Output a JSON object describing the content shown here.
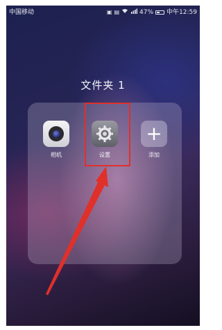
{
  "status_bar": {
    "carrier": "中国移动",
    "battery_percent": "47%",
    "battery_level": 0.47,
    "time": "中午12:59",
    "icons": [
      "nfc-icon",
      "hd-icon",
      "wifi-icon",
      "signal-icon",
      "battery-icon"
    ]
  },
  "folder": {
    "title": "文件夹 1",
    "apps": [
      {
        "label": "相机",
        "icon": "camera-icon"
      },
      {
        "label": "设置",
        "icon": "gear-icon"
      },
      {
        "label": "添加",
        "icon": "plus-icon"
      }
    ]
  },
  "annotation": {
    "color": "#e0302a",
    "target": "设置"
  }
}
